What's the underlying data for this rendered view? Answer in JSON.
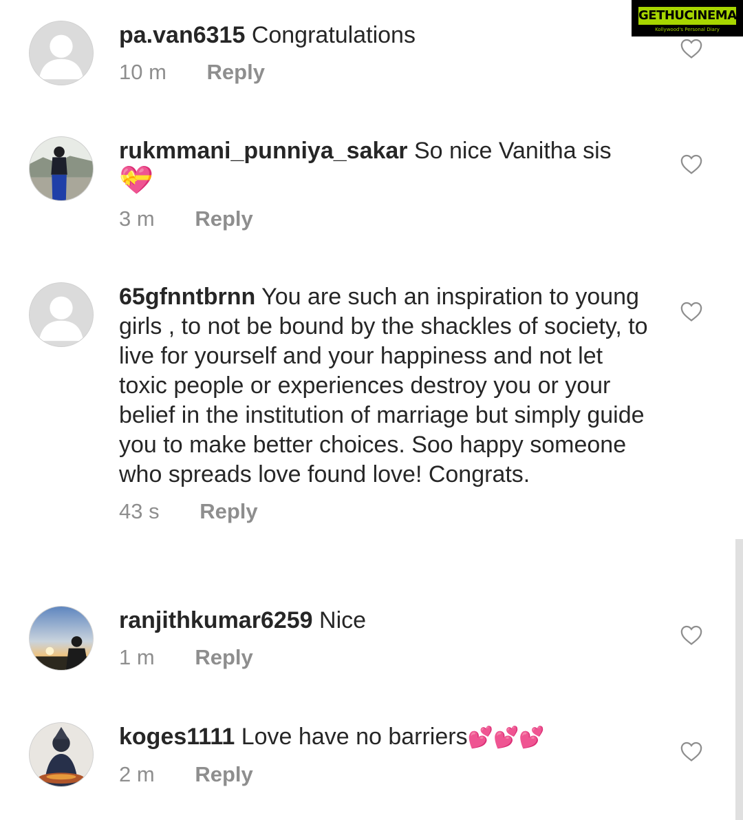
{
  "watermark": {
    "title": "GETHUCINEMA",
    "subtitle": "Kollywood's Personal Diary"
  },
  "comments": [
    {
      "username": "pa.van6315",
      "text": "Congratulations",
      "emoji": "",
      "time": "10 m",
      "reply": "Reply",
      "avatar": "default-avatar"
    },
    {
      "username": "rukmmani_punniya_sakar",
      "text": "So nice Vanitha sis",
      "emoji": "💝",
      "time": "3 m",
      "reply": "Reply",
      "avatar": "person-photo-avatar"
    },
    {
      "username": "65gfnntbrnn",
      "text": "You are such an inspiration to young girls , to not be bound by the shackles of society, to live for yourself and your happiness and not let toxic people or experiences destroy you or your belief in the institution of marriage but simply guide you to make better choices. Soo happy someone who spreads love found love! Congrats.",
      "emoji": "",
      "time": "43 s",
      "reply": "Reply",
      "avatar": "default-avatar"
    },
    {
      "username": "ranjithkumar6259",
      "text": "Nice",
      "emoji": "",
      "time": "1 m",
      "reply": "Reply",
      "avatar": "sunset-photo-avatar"
    },
    {
      "username": "koges1111",
      "text": "Love have no barriers",
      "emoji": "💕💕💕",
      "time": "2 m",
      "reply": "Reply",
      "avatar": "statue-photo-avatar"
    }
  ],
  "colors": {
    "text": "#262626",
    "muted": "#8e8e8e",
    "watermark_accent": "#a7d600",
    "heart": "#8e8e8e"
  },
  "icons": {
    "like": "heart-outline-icon"
  }
}
